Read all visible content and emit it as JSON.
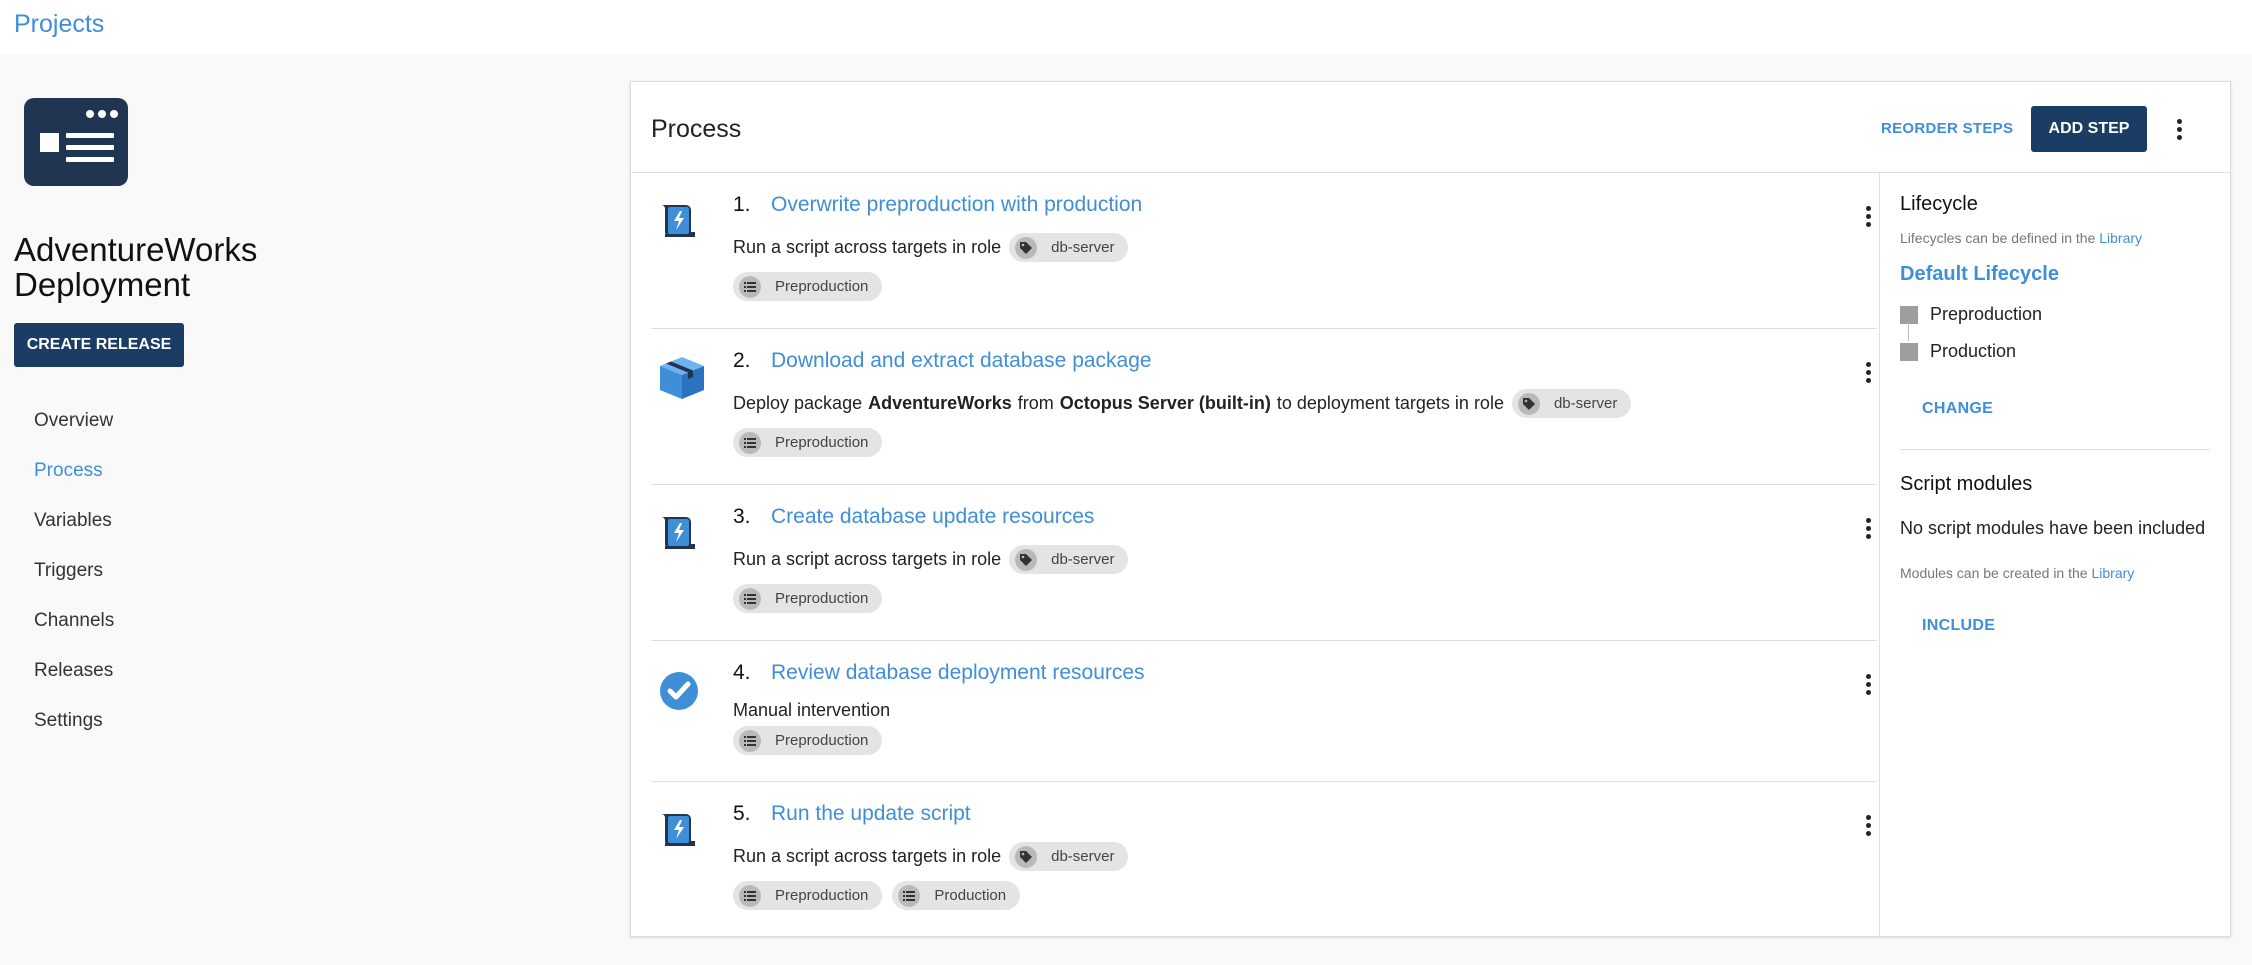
{
  "breadcrumb": {
    "label": "Projects"
  },
  "project": {
    "name_line1": "AdventureWorks",
    "name_line2": "Deployment",
    "create_release_label": "CREATE RELEASE"
  },
  "nav": {
    "items": [
      {
        "label": "Overview",
        "active": false
      },
      {
        "label": "Process",
        "active": true
      },
      {
        "label": "Variables",
        "active": false
      },
      {
        "label": "Triggers",
        "active": false
      },
      {
        "label": "Channels",
        "active": false
      },
      {
        "label": "Releases",
        "active": false
      },
      {
        "label": "Settings",
        "active": false
      }
    ]
  },
  "process": {
    "title": "Process",
    "reorder_label": "REORDER STEPS",
    "add_step_label": "ADD STEP",
    "steps": [
      {
        "number": "1.",
        "title": "Overwrite preproduction with production",
        "icon": "script-icon",
        "desc_text": "Run a script across targets in role",
        "role": "db-server",
        "environments": [
          "Preproduction"
        ]
      },
      {
        "number": "2.",
        "title": "Download and extract database package",
        "icon": "package-icon",
        "desc_prefix": "Deploy package",
        "package": "AdventureWorks",
        "desc_from": "from",
        "feed": "Octopus Server (built-in)",
        "desc_suffix": "to deployment targets in role",
        "role": "db-server",
        "environments": [
          "Preproduction"
        ]
      },
      {
        "number": "3.",
        "title": "Create database update resources",
        "icon": "script-icon",
        "desc_text": "Run a script across targets in role",
        "role": "db-server",
        "environments": [
          "Preproduction"
        ]
      },
      {
        "number": "4.",
        "title": "Review database deployment resources",
        "icon": "check-circle-icon",
        "desc_text": "Manual intervention",
        "environments": [
          "Preproduction"
        ]
      },
      {
        "number": "5.",
        "title": "Run the update script",
        "icon": "script-icon",
        "desc_text": "Run a script across targets in role",
        "role": "db-server",
        "environments": [
          "Preproduction",
          "Production"
        ]
      }
    ]
  },
  "lifecycle": {
    "heading": "Lifecycle",
    "hint_text": "Lifecycles can be defined in the",
    "hint_link": "Library",
    "name": "Default Lifecycle",
    "phases": [
      "Preproduction",
      "Production"
    ],
    "change_label": "CHANGE"
  },
  "script_modules": {
    "heading": "Script modules",
    "empty_text": "No script modules have been included",
    "hint_text": "Modules can be created in the",
    "hint_link": "Library",
    "include_label": "INCLUDE"
  },
  "colors": {
    "accent": "#3f8ed8",
    "primary_button": "#1b3c63",
    "logo_bg": "#1f3552",
    "chip_bg": "#e4e4e4"
  }
}
